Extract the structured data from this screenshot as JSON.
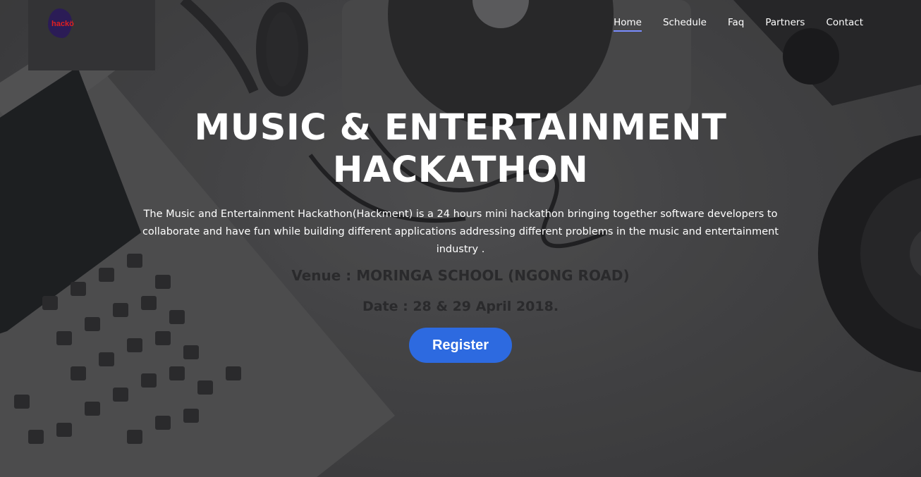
{
  "logo": {
    "text": "hackö"
  },
  "nav": {
    "items": [
      {
        "label": "Home"
      },
      {
        "label": "Schedule"
      },
      {
        "label": "Faq"
      },
      {
        "label": "Partners"
      },
      {
        "label": "Contact"
      }
    ],
    "active": "Home",
    "active_color": "#7a8cff"
  },
  "hero": {
    "title_line1": "MUSIC & ENTERTAINMENT",
    "title_line2": "HACKATHON",
    "description": "The Music and Entertainment Hackathon(Hackment) is a 24 hours mini hackathon bringing together software developers to collaborate and have fun while building different applications addressing different problems in the music and entertainment industry .",
    "venue": "Venue : MORINGA SCHOOL (NGONG ROAD)",
    "date": "Date : 28 & 29 April 2018.",
    "register_label": "Register",
    "register_color": "#2d6ae0"
  }
}
